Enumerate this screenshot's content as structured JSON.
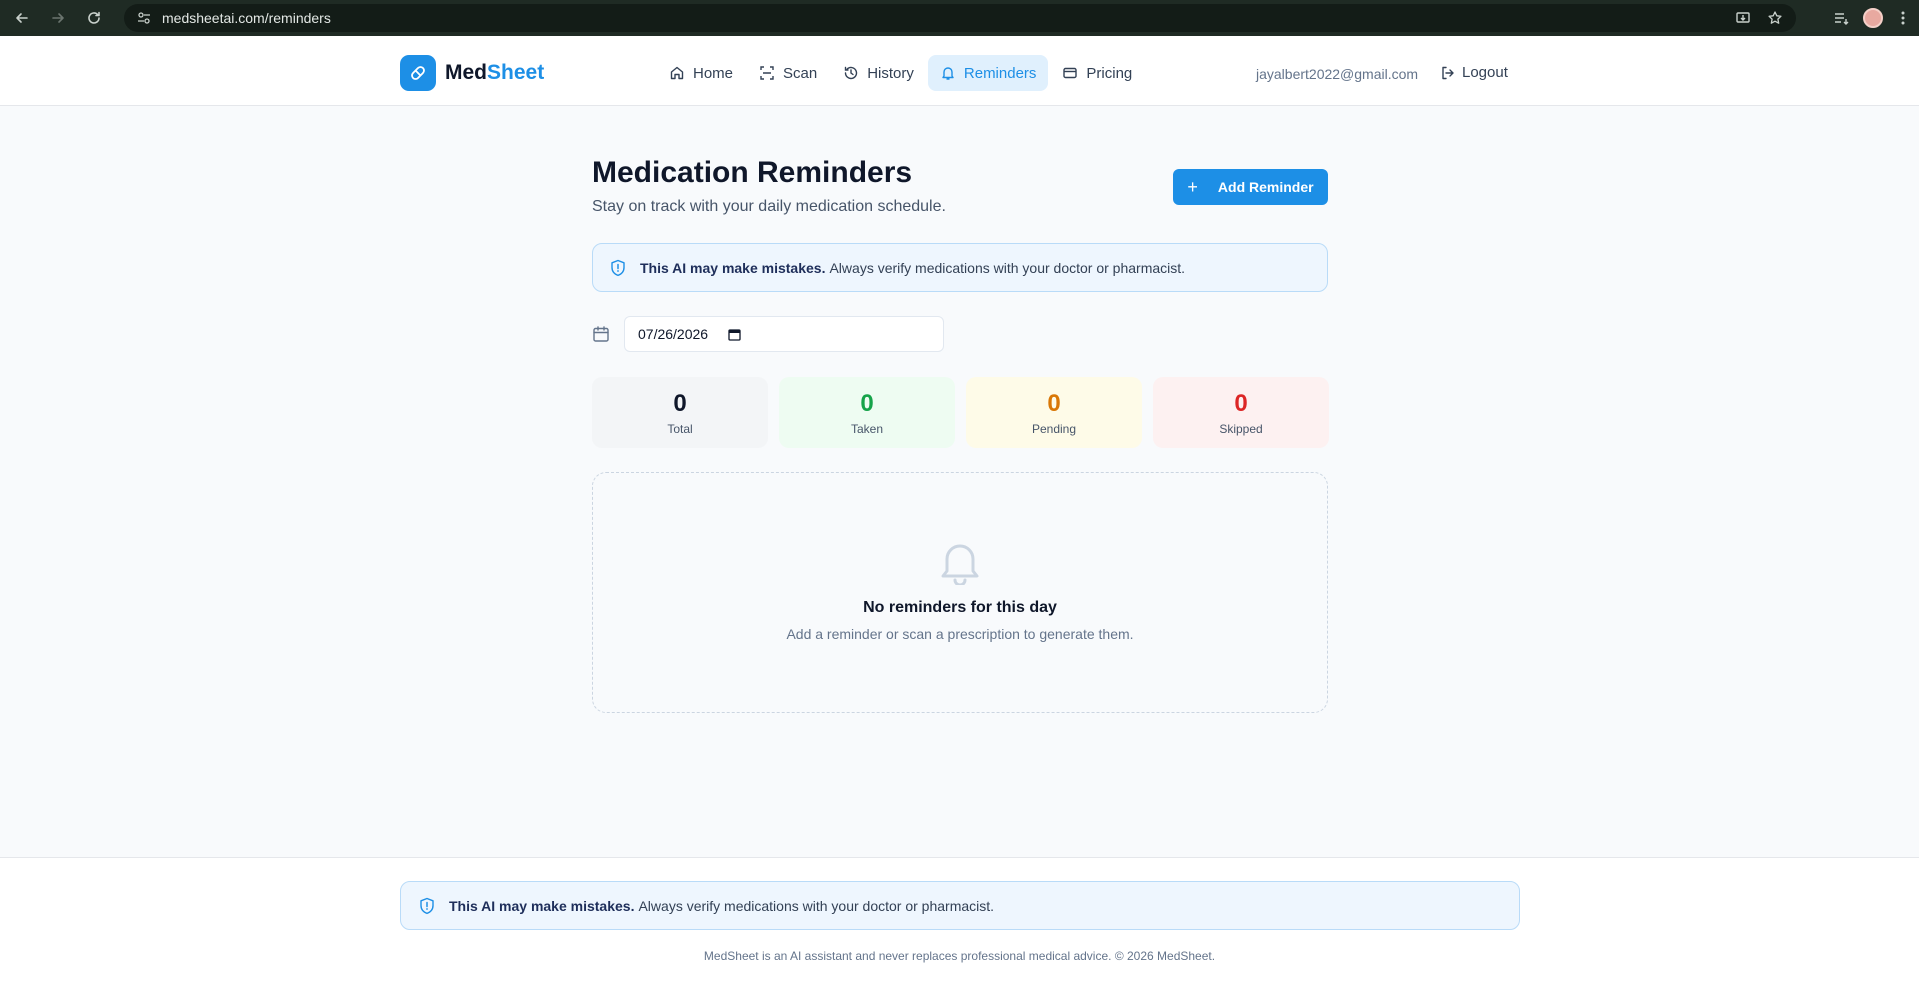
{
  "browser": {
    "url": "medsheetai.com/reminders",
    "icons": [
      "back-arrow-icon",
      "forward-arrow-icon",
      "reload-icon",
      "site-info-icon",
      "install-app-icon",
      "bookmark-star-icon",
      "reading-list-icon",
      "profile-avatar",
      "more-menu-icon"
    ]
  },
  "brand": {
    "name_part1": "Med",
    "name_part2": "Sheet",
    "accent_color": "#1d8fe6",
    "icon": "pill-icon"
  },
  "nav": {
    "items": [
      {
        "label": "Home",
        "icon": "home-icon"
      },
      {
        "label": "Scan",
        "icon": "scan-icon"
      },
      {
        "label": "History",
        "icon": "history-icon"
      },
      {
        "label": "Reminders",
        "icon": "bell-icon",
        "active": true
      },
      {
        "label": "Pricing",
        "icon": "card-icon"
      }
    ]
  },
  "user": {
    "email": "jayalbert2022@gmail.com",
    "logout_label": "Logout"
  },
  "page": {
    "title": "Medication Reminders",
    "subtitle": "Stay on track with your daily medication schedule.",
    "add_button": "Add Reminder"
  },
  "disclaimer": {
    "strong": "This AI may make mistakes.",
    "text": "Always verify medications with your doctor or pharmacist."
  },
  "date_picker": {
    "value": "07/26/2026"
  },
  "stats": {
    "total": {
      "value": "0",
      "label": "Total"
    },
    "taken": {
      "value": "0",
      "label": "Taken",
      "color": "#16a34a"
    },
    "pending": {
      "value": "0",
      "label": "Pending",
      "color": "#d97706"
    },
    "skipped": {
      "value": "0",
      "label": "Skipped",
      "color": "#dc2626"
    }
  },
  "empty_state": {
    "title": "No reminders for this day",
    "subtitle": "Add a reminder or scan a prescription to generate them."
  },
  "footer": {
    "text": "MedSheet is an AI assistant and never replaces professional medical advice. © 2026 MedSheet."
  }
}
